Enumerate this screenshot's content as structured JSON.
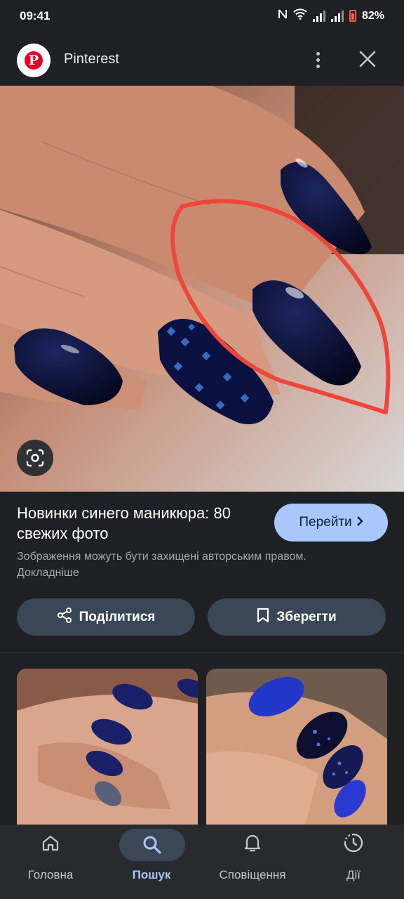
{
  "status_bar": {
    "time": "09:41",
    "battery": "82%"
  },
  "header": {
    "site_name": "Pinterest"
  },
  "result": {
    "title": "Новинки синего маникюра: 80 свежих фото",
    "goto_label": "Перейти",
    "copyright": "Зображення можуть бути захищені авторським правом. Докладніше"
  },
  "actions": {
    "share_label": "Поділитися",
    "save_label": "Зберегти"
  },
  "bottom_nav": {
    "items": [
      {
        "label": "Головна",
        "icon": "home-icon"
      },
      {
        "label": "Пошук",
        "icon": "search-icon",
        "active": true
      },
      {
        "label": "Сповіщення",
        "icon": "bell-icon"
      },
      {
        "label": "Дії",
        "icon": "activity-icon"
      }
    ]
  },
  "colors": {
    "accent": "#a8c7fa",
    "background": "#1f2023",
    "chip": "#3b4757",
    "pinterest_red": "#e60023"
  }
}
